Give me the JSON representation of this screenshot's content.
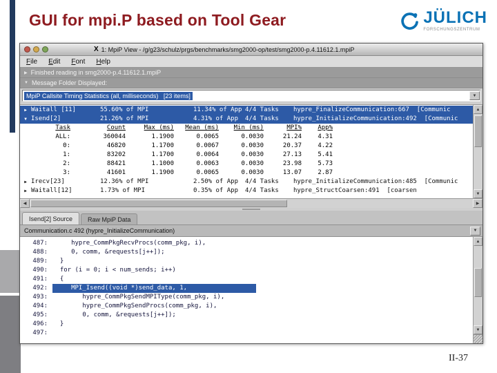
{
  "slide": {
    "title": "GUI for mpi.P based on Tool Gear",
    "page_number": "II-37"
  },
  "logo": {
    "name": "JÜLICH",
    "subtitle": "FORSCHUNGSZENTRUM"
  },
  "icons": {
    "app": "X",
    "dropdown": "▼",
    "scroll_up": "▲",
    "scroll_down": "▼",
    "scroll_left": "◀",
    "scroll_right": "▶"
  },
  "window": {
    "title": "1: MpiP View - /g/g23/schulz/prgs/benchmarks/smg2000-op/test/smg2000-p.4.11612.1.mpiP",
    "menu": {
      "file": "File",
      "edit": "Edit",
      "font": "Font",
      "help": "Help"
    },
    "messages": {
      "expander1": "▶",
      "line1": "Finished reading in smg2000-p.4.11612.1.mpiP",
      "expander2": "▼",
      "line2": "Message Folder Displayed:"
    },
    "stats_selector": "MpiP Callsite Timing Statistics (all, milliseconds)   [23 items]",
    "callsites": [
      {
        "expander": "▶",
        "name": "Waitall [11]",
        "mpi": "55.60% of MPI",
        "app": "11.34% of App",
        "tasks": "4/4 Tasks",
        "site": "hypre_FinalizeCommunication:667  [Communic"
      },
      {
        "expander": "▼",
        "name": "Isend[2]",
        "mpi": "21.26% of MPI",
        "app": "4.31% of App",
        "tasks": "4/4 Tasks",
        "site": "hypre_InitializeCommunication:492  [Communic"
      },
      {
        "expander": "▶",
        "name": "Irecv[23]",
        "mpi": "12.36% of MPI",
        "app": "2.50% of App",
        "tasks": "4/4 Tasks",
        "site": "hypre_InitializeCommunication:485  [Communic"
      },
      {
        "expander": "▶",
        "name": "Waitall[12]",
        "mpi": "1.73% of MPI",
        "app": "0.35% of App",
        "tasks": "4/4 Tasks",
        "site": "hypre_StructCoarsen:491  [coarsen"
      }
    ],
    "task_table": {
      "headers": [
        "Task",
        "Count",
        "Max (ms)",
        "Mean (ms)",
        "Min (ms)",
        "MPI%",
        "App%"
      ],
      "rows": [
        [
          "ALL:",
          "360044",
          "1.1900",
          "0.0065",
          "0.0030",
          "21.24",
          "4.31"
        ],
        [
          "0:",
          "46820",
          "1.1700",
          "0.0067",
          "0.0030",
          "20.37",
          "4.22"
        ],
        [
          "1:",
          "83202",
          "1.1700",
          "0.0064",
          "0.0030",
          "27.13",
          "5.41"
        ],
        [
          "2:",
          "88421",
          "1.1000",
          "0.0063",
          "0.0030",
          "23.98",
          "5.73"
        ],
        [
          "3:",
          "41601",
          "1.1900",
          "0.0065",
          "0.0030",
          "13.07",
          "2.87"
        ]
      ]
    },
    "tabs": [
      {
        "label": "Isend[2] Source"
      },
      {
        "label": "Raw MpiP Data"
      }
    ],
    "source_header": "Communication.c 492 (hypre_InitializeCommunication)",
    "source": [
      {
        "num": "487:",
        "code": "     hypre_CommPkgRecvProcs(comm_pkg, i),"
      },
      {
        "num": "488:",
        "code": "     0, comm, &requests[j++]);"
      },
      {
        "num": "489:",
        "code": "  }"
      },
      {
        "num": "490:",
        "code": "  for (i = 0; i < num_sends; i++)"
      },
      {
        "num": "491:",
        "code": "  {"
      },
      {
        "num": "492:",
        "code": "     MPI_Isend((void *)send_data, 1,"
      },
      {
        "num": "493:",
        "code": "        hypre_CommPkgSendMPIType(comm_pkg, i),"
      },
      {
        "num": "494:",
        "code": "        hypre_CommPkgSendProcs(comm_pkg, i),"
      },
      {
        "num": "495:",
        "code": "        0, comm, &requests[j++]);"
      },
      {
        "num": "496:",
        "code": "  }"
      },
      {
        "num": "497:",
        "code": ""
      }
    ],
    "colors": {
      "selection_blue": "#2d5aa6",
      "title_red": "#8e1b20",
      "juelich_blue": "#0b72b5"
    }
  }
}
